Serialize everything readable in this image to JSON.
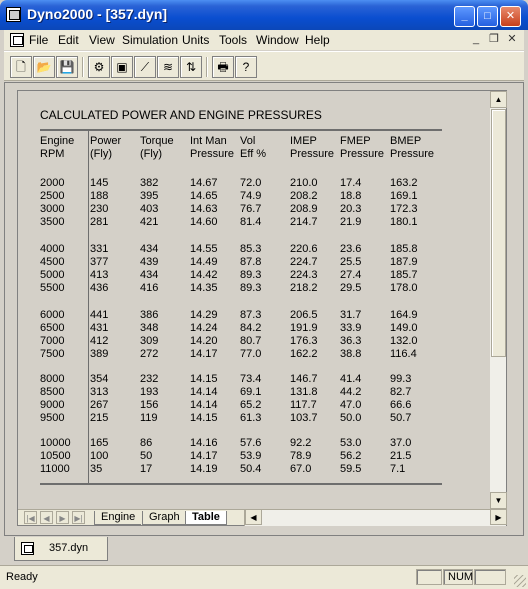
{
  "window": {
    "title": "Dyno2000 - [357.dyn]",
    "buttons": {
      "minimize": "_",
      "maximize": "□",
      "close": "✕"
    }
  },
  "menu": {
    "items": [
      "File",
      "Edit",
      "View",
      "Simulation",
      "Units",
      "Tools",
      "Window",
      "Help"
    ],
    "mdi_buttons": {
      "minimize": "_",
      "restore": "❐",
      "close": "✕"
    }
  },
  "toolbar": {
    "buttons": [
      {
        "name": "new-icon",
        "glyph": "🗋"
      },
      {
        "name": "open-icon",
        "glyph": "📂"
      },
      {
        "name": "save-icon",
        "glyph": "💾"
      },
      {
        "name": "engine-icon",
        "glyph": "⚙"
      },
      {
        "name": "cylinder-icon",
        "glyph": "▣"
      },
      {
        "name": "valve-icon",
        "glyph": "⟋"
      },
      {
        "name": "camshaft-icon",
        "glyph": "≋"
      },
      {
        "name": "compare-icon",
        "glyph": "⇅"
      },
      {
        "name": "print-icon",
        "glyph": "🖶"
      },
      {
        "name": "help-icon",
        "glyph": "?"
      }
    ]
  },
  "document": {
    "heading": "CALCULATED POWER AND ENGINE PRESSURES",
    "columns": [
      [
        "Engine",
        "RPM"
      ],
      [
        "Power",
        "(Fly)"
      ],
      [
        "Torque",
        "(Fly)"
      ],
      [
        "Int Man",
        "Pressure"
      ],
      [
        "Vol",
        "Eff %"
      ],
      [
        "IMEP",
        "Pressure"
      ],
      [
        "FMEP",
        "Pressure"
      ],
      [
        "BMEP",
        "Pressure"
      ]
    ],
    "groups": [
      [
        [
          "2000",
          "145",
          "382",
          "14.67",
          "72.0",
          "210.0",
          "17.4",
          "163.2"
        ],
        [
          "2500",
          "188",
          "395",
          "14.65",
          "74.9",
          "208.2",
          "18.8",
          "169.1"
        ],
        [
          "3000",
          "230",
          "403",
          "14.63",
          "76.7",
          "208.9",
          "20.3",
          "172.3"
        ],
        [
          "3500",
          "281",
          "421",
          "14.60",
          "81.4",
          "214.7",
          "21.9",
          "180.1"
        ]
      ],
      [
        [
          "4000",
          "331",
          "434",
          "14.55",
          "85.3",
          "220.6",
          "23.6",
          "185.8"
        ],
        [
          "4500",
          "377",
          "439",
          "14.49",
          "87.8",
          "224.7",
          "25.5",
          "187.9"
        ],
        [
          "5000",
          "413",
          "434",
          "14.42",
          "89.3",
          "224.3",
          "27.4",
          "185.7"
        ],
        [
          "5500",
          "436",
          "416",
          "14.35",
          "89.3",
          "218.2",
          "29.5",
          "178.0"
        ]
      ],
      [
        [
          "6000",
          "441",
          "386",
          "14.29",
          "87.3",
          "206.5",
          "31.7",
          "164.9"
        ],
        [
          "6500",
          "431",
          "348",
          "14.24",
          "84.2",
          "191.9",
          "33.9",
          "149.0"
        ],
        [
          "7000",
          "412",
          "309",
          "14.20",
          "80.7",
          "176.3",
          "36.3",
          "132.0"
        ],
        [
          "7500",
          "389",
          "272",
          "14.17",
          "77.0",
          "162.2",
          "38.8",
          "116.4"
        ]
      ],
      [
        [
          "8000",
          "354",
          "232",
          "14.15",
          "73.4",
          "146.7",
          "41.4",
          "99.3"
        ],
        [
          "8500",
          "313",
          "193",
          "14.14",
          "69.1",
          "131.8",
          "44.2",
          "82.7"
        ],
        [
          "9000",
          "267",
          "156",
          "14.14",
          "65.2",
          "117.7",
          "47.0",
          "66.6"
        ],
        [
          "9500",
          "215",
          "119",
          "14.15",
          "61.3",
          "103.7",
          "50.0",
          "50.7"
        ]
      ],
      [
        [
          "10000",
          "165",
          "86",
          "14.16",
          "57.6",
          "92.2",
          "53.0",
          "37.0"
        ],
        [
          "10500",
          "100",
          "50",
          "14.17",
          "53.9",
          "78.9",
          "56.2",
          "21.5"
        ],
        [
          "11000",
          "35",
          "17",
          "14.19",
          "50.4",
          "67.0",
          "59.5",
          "7.1"
        ]
      ]
    ],
    "sheet_tabs": [
      {
        "label": "Engine",
        "active": false
      },
      {
        "label": "Graph",
        "active": false
      },
      {
        "label": "Table",
        "active": true
      }
    ]
  },
  "window_tab": {
    "label": "357.dyn"
  },
  "status": {
    "text": "Ready",
    "num": "NUM"
  }
}
